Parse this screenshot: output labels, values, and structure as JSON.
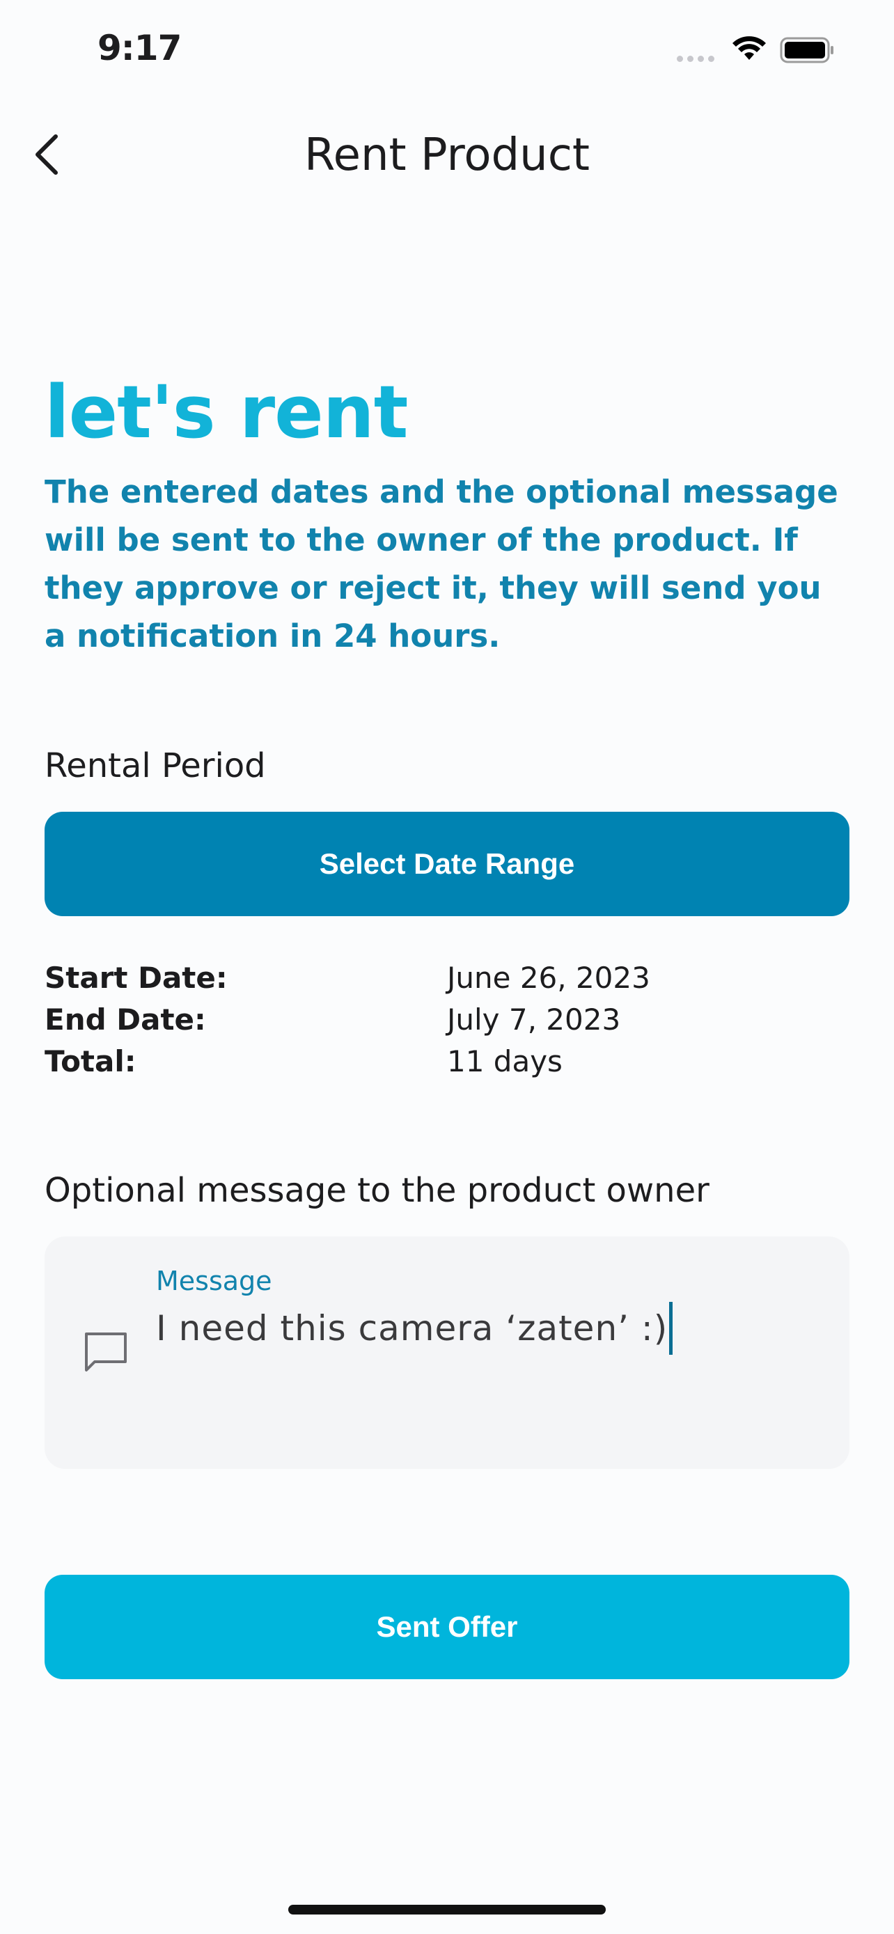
{
  "status_bar": {
    "time": "9:17"
  },
  "nav": {
    "title": "Rent Product",
    "back_icon": "chevron-left-icon"
  },
  "hero": {
    "title": "let's rent",
    "description": "The entered dates and the optional message will be sent to the owner of the product. If they approve or reject it, they will send you a notification in 24 hours."
  },
  "rental": {
    "section_label": "Rental Period",
    "button_label": "Select Date Range",
    "start_label": "Start Date:",
    "start_value": "June 26, 2023",
    "end_label": "End Date:",
    "end_value": "July 7, 2023",
    "total_label": "Total:",
    "total_value": "11 days"
  },
  "message": {
    "section_label": "Optional message to the product owner",
    "field_label": "Message",
    "value": "I need this camera ‘zaten’ :)",
    "icon": "chat-bubble-icon"
  },
  "actions": {
    "submit_label": "Sent Offer"
  },
  "colors": {
    "accent": "#12b3d8",
    "primary_dark": "#0083b2",
    "primary_light": "#00b5dc",
    "text_teal": "#1183ad"
  }
}
